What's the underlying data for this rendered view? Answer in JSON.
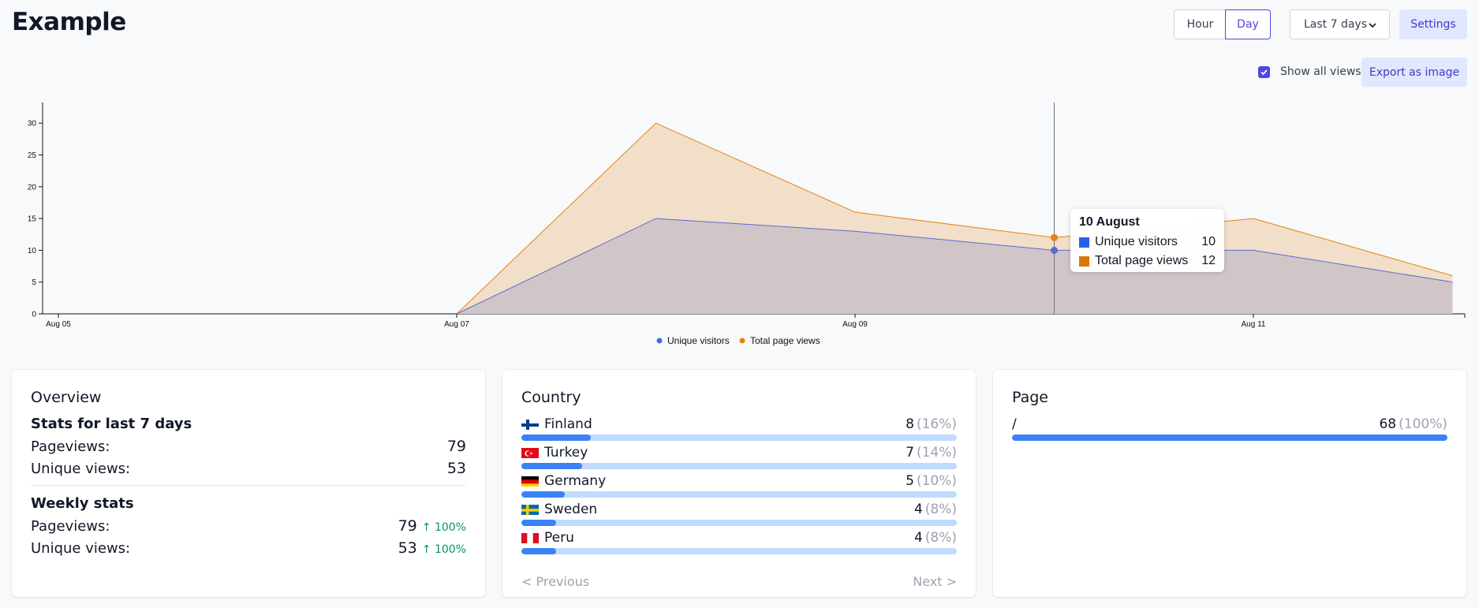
{
  "header": {
    "title": "Example",
    "hour_label": "Hour",
    "day_label": "Day",
    "range_label": "Last 7 days",
    "settings_label": "Settings",
    "show_all_label": "Show all views",
    "export_label": "Export as image"
  },
  "chart_data": {
    "type": "area",
    "x": [
      "Aug 05",
      "Aug 06",
      "Aug 07",
      "Aug 08",
      "Aug 09",
      "Aug 10",
      "Aug 11",
      "Aug 12"
    ],
    "xticks": [
      "Aug 05",
      "Aug 07",
      "Aug 09",
      "Aug 11"
    ],
    "yticks": [
      0,
      5,
      10,
      15,
      20,
      25,
      30
    ],
    "ylim": [
      0,
      33
    ],
    "series": [
      {
        "name": "Unique visitors",
        "color": "#5b6ccf",
        "values": [
          null,
          null,
          0,
          15,
          13,
          10,
          10,
          5
        ]
      },
      {
        "name": "Total page views",
        "color": "#e8830f",
        "values": [
          null,
          null,
          0,
          30,
          16,
          12,
          15,
          6
        ]
      }
    ],
    "legend": "bottom-center",
    "tooltip": {
      "title": "10 August",
      "index": 5,
      "rows": [
        {
          "label": "Unique visitors",
          "value": "10",
          "color": "#2563eb"
        },
        {
          "label": "Total page views",
          "value": "12",
          "color": "#d97706"
        }
      ]
    }
  },
  "overview": {
    "title": "Overview",
    "stats_heading": "Stats for last 7 days",
    "pageviews_label": "Pageviews:",
    "pageviews_value": "79",
    "unique_label": "Unique views:",
    "unique_value": "53",
    "weekly_heading": "Weekly stats",
    "weekly_pageviews_label": "Pageviews:",
    "weekly_pageviews_value": "79",
    "weekly_pageviews_trend": "↑ 100%",
    "weekly_unique_label": "Unique views:",
    "weekly_unique_value": "53",
    "weekly_unique_trend": "↑ 100%"
  },
  "country": {
    "title": "Country",
    "rows": [
      {
        "name": "Finland",
        "count": "8",
        "pct": "(16%)",
        "fraction": 0.16,
        "flag": "finland-flag"
      },
      {
        "name": "Turkey",
        "count": "7",
        "pct": "(14%)",
        "fraction": 0.14,
        "flag": "turkey-flag"
      },
      {
        "name": "Germany",
        "count": "5",
        "pct": "(10%)",
        "fraction": 0.1,
        "flag": "germany-flag"
      },
      {
        "name": "Sweden",
        "count": "4",
        "pct": "(8%)",
        "fraction": 0.08,
        "flag": "sweden-flag"
      },
      {
        "name": "Peru",
        "count": "4",
        "pct": "(8%)",
        "fraction": 0.08,
        "flag": "peru-flag"
      }
    ],
    "prev_label": "< Previous",
    "next_label": "Next >"
  },
  "page_card": {
    "title": "Page",
    "rows": [
      {
        "name": "/",
        "count": "68",
        "pct": "(100%)",
        "fraction": 1.0
      }
    ]
  }
}
